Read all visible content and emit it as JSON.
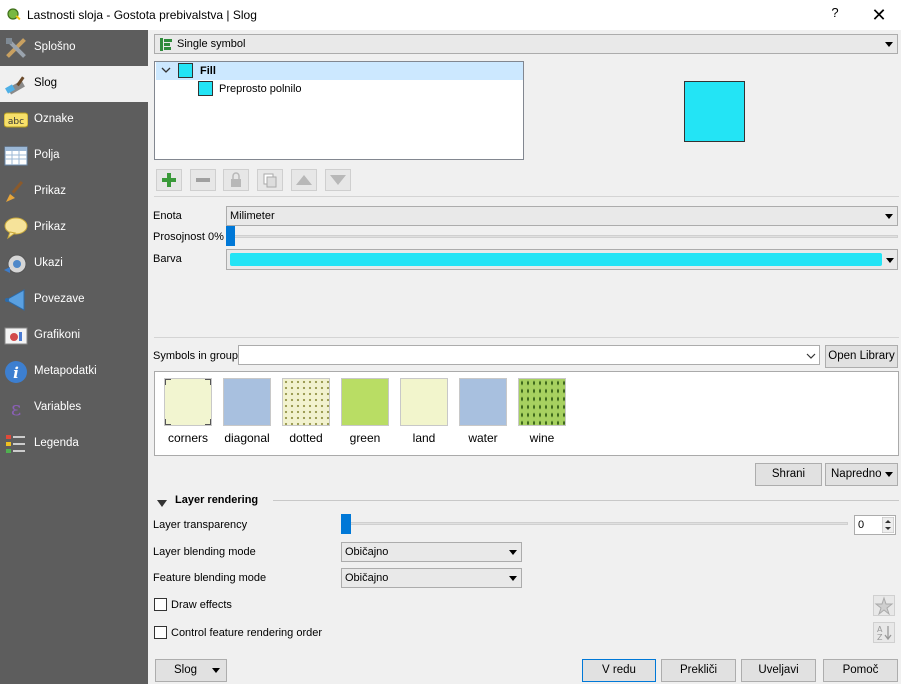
{
  "window": {
    "title": "Lastnosti sloja - Gostota prebivalstva | Slog",
    "help_label": "?",
    "close_label": "✕"
  },
  "sidebar": {
    "items": [
      {
        "label": "Splošno",
        "icon": "tools-icon"
      },
      {
        "label": "Slog",
        "icon": "paintbrush-icon",
        "active": true
      },
      {
        "label": "Oznake",
        "icon": "abc-label-icon"
      },
      {
        "label": "Polja",
        "icon": "table-icon"
      },
      {
        "label": "Prikaz",
        "icon": "brush-icon"
      },
      {
        "label": "Prikaz",
        "icon": "speech-bubble-icon"
      },
      {
        "label": "Ukazi",
        "icon": "gear-action-icon"
      },
      {
        "label": "Povezave",
        "icon": "join-icon"
      },
      {
        "label": "Grafikoni",
        "icon": "diagram-icon"
      },
      {
        "label": "Metapodatki",
        "icon": "info-icon"
      },
      {
        "label": "Variables",
        "icon": "epsilon-icon"
      },
      {
        "label": "Legenda",
        "icon": "legend-icon"
      }
    ]
  },
  "renderer": {
    "type": "Single symbol"
  },
  "symbol_tree": {
    "root": "Fill",
    "child": "Preprosto polnilo",
    "fill_color": "#23e4f5"
  },
  "symbol_props": {
    "unit_label": "Enota",
    "unit_value": "Milimeter",
    "opacity_label": "Prosojnost 0%",
    "opacity_value": 0,
    "color_label": "Barva",
    "color_value": "#23e4f5"
  },
  "library": {
    "group_label": "Symbols in group",
    "group_value": "",
    "open_library": "Open Library",
    "symbols": [
      {
        "name": "corners",
        "fill": "#f2f5d0"
      },
      {
        "name": "diagonal",
        "fill": "#a8c0df"
      },
      {
        "name": "dotted",
        "fill": "#f2f2cf"
      },
      {
        "name": "green",
        "fill": "#b9dd64"
      },
      {
        "name": "land",
        "fill": "#f2f5cc"
      },
      {
        "name": "water",
        "fill": "#a8c0df"
      },
      {
        "name": "wine",
        "fill": "#a7d160"
      }
    ],
    "save_label": "Shrani",
    "advanced_label": "Napredno"
  },
  "layer_rendering": {
    "header": "Layer rendering",
    "transparency_label": "Layer transparency",
    "transparency_value": "0",
    "blending_label": "Layer blending mode",
    "blending_value": "Običajno",
    "feature_blending_label": "Feature blending mode",
    "feature_blending_value": "Običajno",
    "draw_effects_label": "Draw effects",
    "draw_effects_checked": false,
    "control_order_label": "Control feature rendering order",
    "control_order_checked": false
  },
  "footer": {
    "style_label": "Slog",
    "ok_label": "V redu",
    "cancel_label": "Prekliči",
    "apply_label": "Uveljavi",
    "help_label": "Pomoč"
  }
}
